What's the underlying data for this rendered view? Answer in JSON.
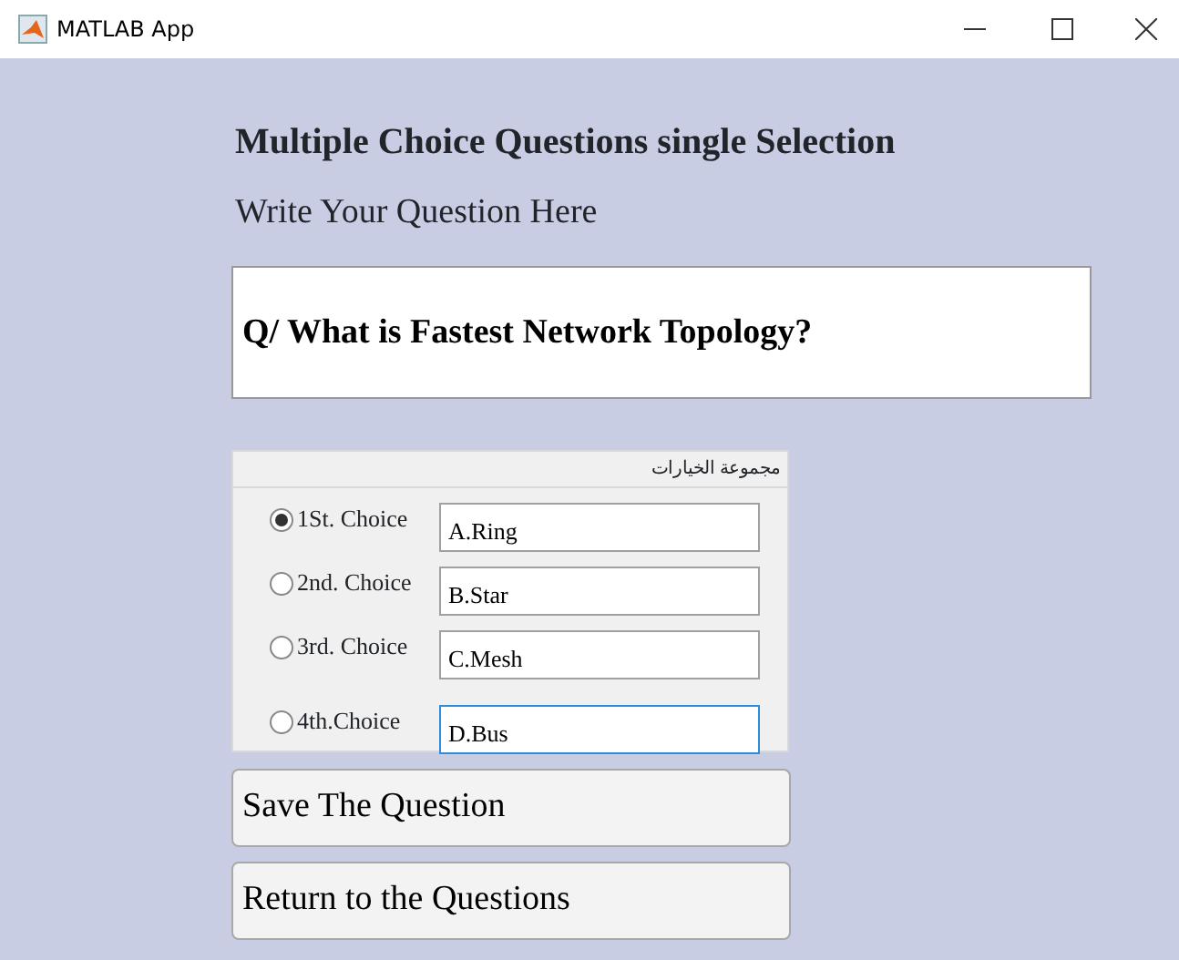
{
  "window": {
    "title": "MATLAB App"
  },
  "heading": "Multiple Choice Questions  single Selection",
  "subheading": "Write Your Question Here",
  "question": {
    "value": "Q/ What is Fastest Network Topology?"
  },
  "choices_panel": {
    "title": "مجموعة الخيارات",
    "choices": [
      {
        "label": "1St. Choice",
        "selected": true,
        "answer": "A.Ring",
        "focused": false
      },
      {
        "label": "2nd. Choice",
        "selected": false,
        "answer": "B.Star",
        "focused": false
      },
      {
        "label": "3rd. Choice",
        "selected": false,
        "answer": "C.Mesh",
        "focused": false
      },
      {
        "label": "4th.Choice",
        "selected": false,
        "answer": "D.Bus",
        "focused": true
      }
    ]
  },
  "buttons": [
    "Save The Question",
    "Return to the Questions"
  ]
}
